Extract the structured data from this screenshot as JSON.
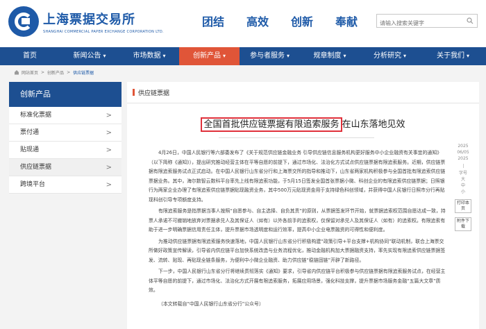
{
  "header": {
    "logo_text": "上海票据交易所",
    "logo_en": "SHANGHAI COMMERCIAL PAPER EXCHANGE CORPORATION LTD.",
    "slogans": [
      "团结",
      "高效",
      "创新",
      "奉献"
    ],
    "search_placeholder": "请输入搜索关键字"
  },
  "nav": {
    "items": [
      {
        "label": "首页",
        "has_caret": false
      },
      {
        "label": "新闻公告",
        "has_caret": true
      },
      {
        "label": "市场数据",
        "has_caret": true
      },
      {
        "label": "创新产品",
        "has_caret": true,
        "active": true
      },
      {
        "label": "参与者服务",
        "has_caret": true
      },
      {
        "label": "规章制度",
        "has_caret": true
      },
      {
        "label": "分析研究",
        "has_caret": true
      },
      {
        "label": "关于我们",
        "has_caret": true
      }
    ],
    "caret": "▾"
  },
  "breadcrumb": {
    "items": [
      "网站首页",
      "创新产品",
      "供应链票据"
    ],
    "separator": ">"
  },
  "sidebar": {
    "title": "创新产品",
    "items": [
      {
        "label": "标准化票据",
        "arrow": ">"
      },
      {
        "label": "票付通",
        "arrow": ">"
      },
      {
        "label": "贴现通",
        "arrow": ">"
      },
      {
        "label": "供应链票据",
        "arrow": ">",
        "active": true
      },
      {
        "label": "跨境平台",
        "arrow": ">"
      }
    ]
  },
  "content": {
    "section_title": "供应链票据",
    "article": {
      "title_highlight": "全国首批供应链票据有限追索服务",
      "title_rest": "在山东落地见效",
      "paragraphs": [
        "4月26日，中国人民银行等六部委发布了《关于规范供应链金融业务 引导供应链信息服务机构更好服务中小企业融资有关事宜的通知》（以下简称《通知》），提出研究推动经营主体在平等自愿的前提下，通过市场化、法治化方式试点供应链票据有限追索服务。近期，供应链票据有限追索服务试点正式启动。在中国人民银行山东省分行和上海票交所的指导和推动下，山东省两家机构积极参与全国首批有限追索供应链票据业务。其中，海尔数智云数科平台率先上线有限追索功能，于5月15日签发全国首张票据小微、科创企业的有限追索供应链票据；日照银行为两家企业办理了有限追索供应链票据贴现融资业务，其中500万元贴现资金用于支持绿色科创领域，并获得中国人民银行日照市分行再贴现科创引导专项额度支持。",
        "有限追索服务是指票据当事人按照“自愿参与、自主选择、自负其责”的原则，从票据签发环节开始，就票据追索权范围自愿达成一致，持票人承诺不可撤销地放弃对票据承兑人及其保证人（如有）以外各前手的追索权，仅保留对承兑人及其保证人（如有）的追索权。有限追索有助于进一步明确票据信用责任主体，提升票据市场透明度和运行效率，提高中小企业电票融资的可得性和便利度。",
        "为推动供应链票据有限追索服务快速落地，中国人民银行山东省分行积极构建“政策引导+平台支撑+机构协同”联动机制，联合上海票交所做好政策宣传解读，引导省内供应链平台加快系统改造与业务流程优化，推动金融机构加大票据融资支持，率先实现有限追索供应链票据签发、流转、贴现、再贴现全链条服务，为便利中小微企业融资、助力供应链“稳链固链”开辟了新路径。",
        "下一步，中国人民银行山东省分行将继续贯彻落实《通知》要求，引导省内供应链平台积极参与供应链票据有限追索服务试点，在经营主体平等自愿的前提下，通过市场化、法治化方式开展有限追索服务，拓展应用场景，强化科技支撑，提升票据市场服务金融“五篇大文章”质效。"
      ],
      "source_note": "（本文转载自“中国人民银行山东省分行”公众号）"
    },
    "meta": {
      "date_parts": [
        "2025",
        "06/05",
        "2025"
      ],
      "font_size_label": "字号",
      "font_sizes": [
        "大",
        "中",
        "小"
      ],
      "print_label": "打印本页",
      "attachment_label": "附件下载"
    }
  },
  "colors": {
    "brand_blue": "#1e5aa8",
    "nav_blue": "#1d4f91",
    "active_red": "#e05538",
    "highlight_box": "#e0303a"
  }
}
